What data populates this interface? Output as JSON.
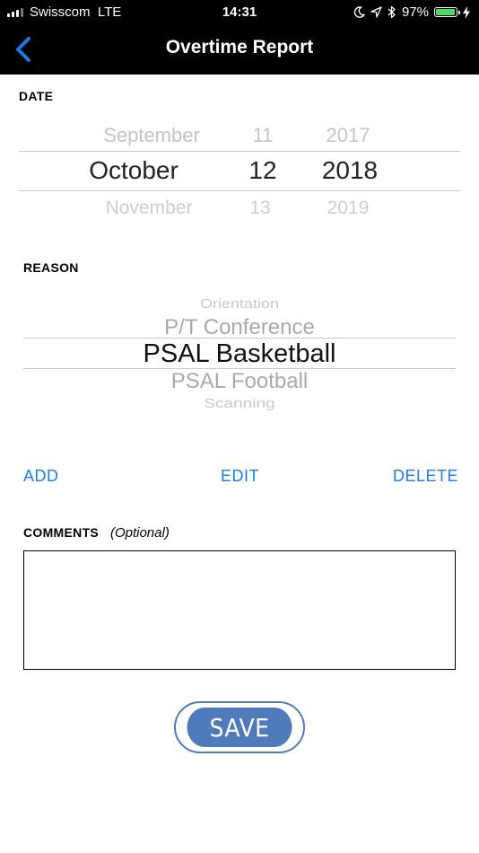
{
  "status_bar": {
    "carrier": "Swisscom",
    "network": "LTE",
    "time": "14:31",
    "battery": "97%",
    "battery_level": 0.97,
    "icons": [
      "signal-icon",
      "moon-icon",
      "location-arrow-icon",
      "bluetooth-icon",
      "battery-icon",
      "charging-bolt-icon"
    ]
  },
  "nav": {
    "title": "Overtime Report",
    "back_icon": "chevron-left-icon"
  },
  "date": {
    "label": "DATE",
    "months": {
      "prev": "September",
      "selected": "October",
      "next": "November"
    },
    "days": {
      "prev": "11",
      "selected": "12",
      "next": "13"
    },
    "years": {
      "prev": "2017",
      "selected": "2018",
      "next": "2019"
    }
  },
  "reason": {
    "label": "REASON",
    "items": [
      "Orientation",
      "P/T Conference",
      "PSAL Basketball",
      "PSAL Football",
      "Scanning"
    ],
    "selected": "PSAL Basketball"
  },
  "actions": {
    "add": "ADD",
    "edit": "EDIT",
    "delete": "DELETE"
  },
  "comments": {
    "label": "COMMENTS",
    "optional": "(Optional)",
    "value": ""
  },
  "save_label": "SAVE",
  "colors": {
    "accent": "#1a7de6",
    "save_button": "#4f7bbd",
    "battery_fill": "#4cd964"
  }
}
